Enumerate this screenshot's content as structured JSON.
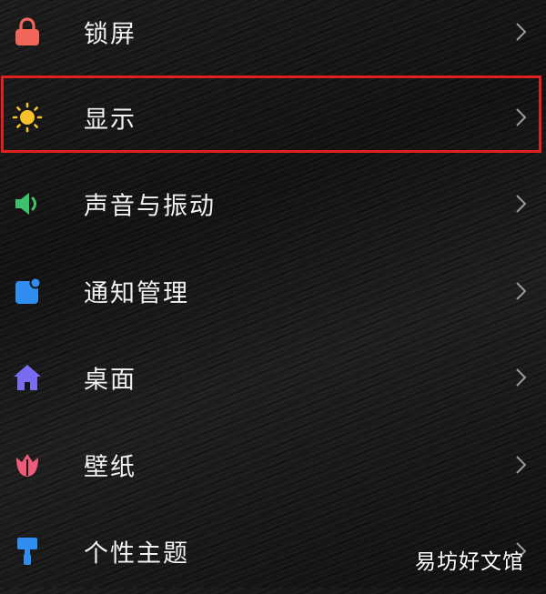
{
  "settings": {
    "items": [
      {
        "label": "锁屏",
        "icon": "lock-icon",
        "icon_color": "#f0675a"
      },
      {
        "label": "显示",
        "icon": "sun-icon",
        "icon_color": "#f6c22b",
        "highlighted": true
      },
      {
        "label": "声音与振动",
        "icon": "speaker-icon",
        "icon_color": "#3cc26b"
      },
      {
        "label": "通知管理",
        "icon": "notification-icon",
        "icon_color": "#2f8ef0"
      },
      {
        "label": "桌面",
        "icon": "home-icon",
        "icon_color": "#7a6cf0"
      },
      {
        "label": "壁纸",
        "icon": "tulip-icon",
        "icon_color": "#ee5a7a"
      },
      {
        "label": "个性主题",
        "icon": "brush-icon",
        "icon_color": "#2f8ef0"
      }
    ],
    "highlight_color": "#e0201c"
  },
  "watermark": {
    "text": "易坊好文馆"
  }
}
